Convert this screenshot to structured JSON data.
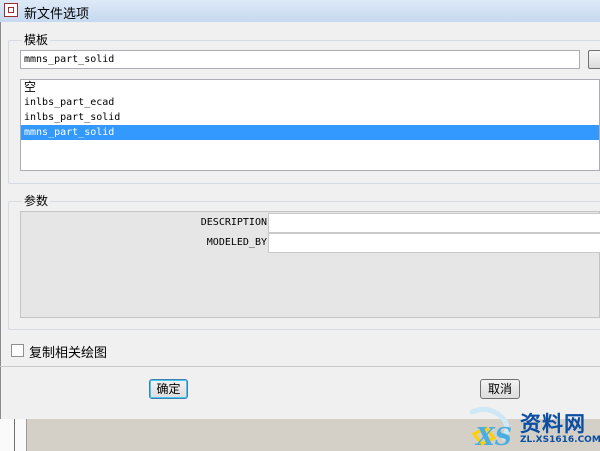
{
  "window": {
    "title": "新文件选项"
  },
  "template_group": {
    "label": "模板",
    "input_value": "mmns_part_solid",
    "items": [
      "空",
      "inlbs_part_ecad",
      "inlbs_part_solid",
      "mmns_part_solid"
    ],
    "selected_index": 3
  },
  "params_group": {
    "label": "参数",
    "rows": [
      {
        "name": "DESCRIPTION",
        "value": ""
      },
      {
        "name": "MODELED_BY",
        "value": ""
      }
    ]
  },
  "copy_drawing": {
    "label": "复制相关绘图",
    "checked": false
  },
  "buttons": {
    "ok": "确定",
    "cancel": "取消"
  },
  "watermark": {
    "title": "资料网",
    "url": "ZL.XS1616.COM"
  },
  "colors": {
    "selection": "#3399ff",
    "watermark": "#0b4ea2"
  }
}
